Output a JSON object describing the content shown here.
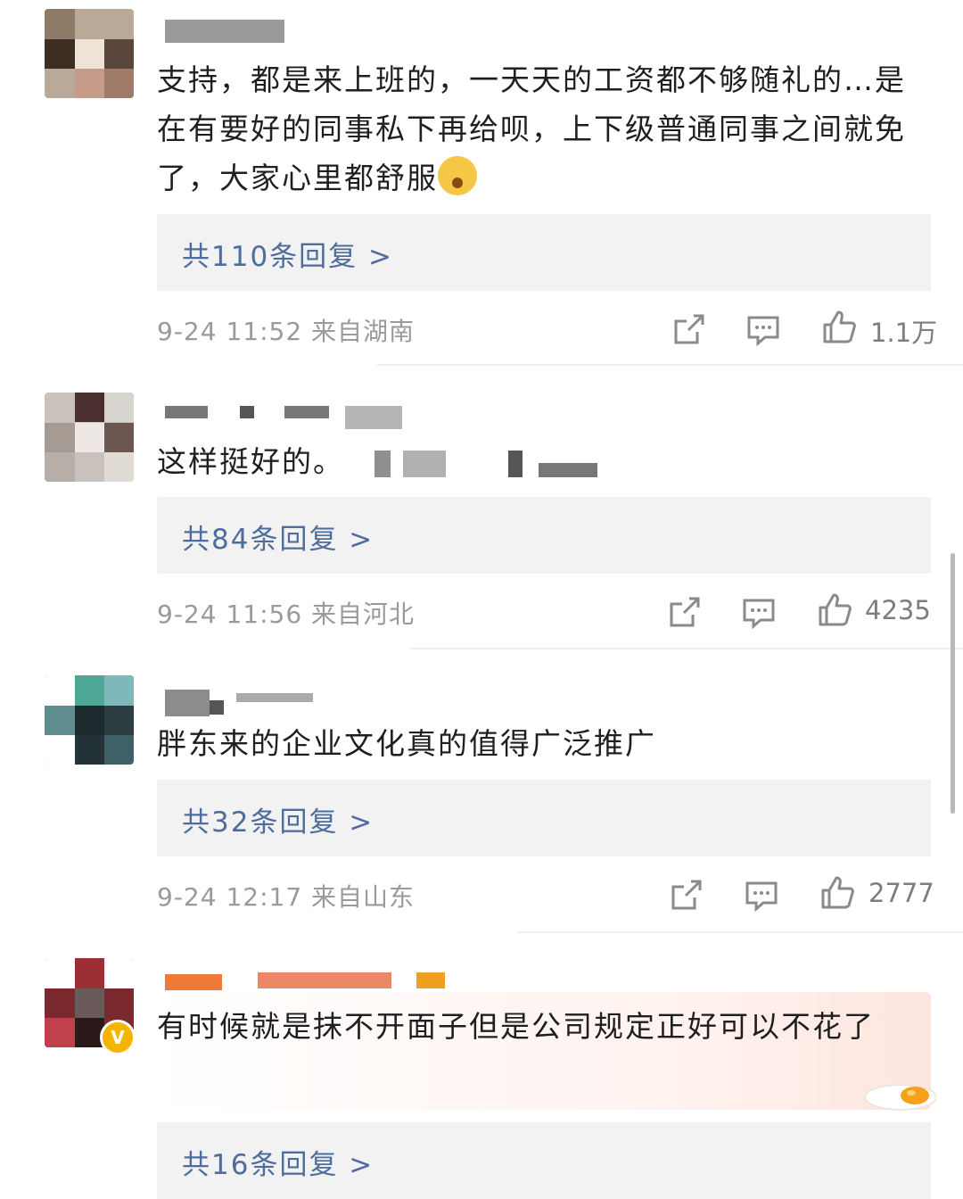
{
  "comments": [
    {
      "text": "支持，都是来上班的，一天天的工资都不够随礼的…是在有要好的同事私下再给呗，上下级普通同事之间就免了，大家心里都舒服",
      "emoji_icon": "face-covering-eyes-emoji",
      "replies": "共110条回复 >",
      "meta": "9-24 11:52  来自湖南",
      "likes": "1.1万"
    },
    {
      "text": "这样挺好的。",
      "replies": "共84条回复 >",
      "meta": "9-24 11:56  来自河北",
      "likes": "4235"
    },
    {
      "text": "胖东来的企业文化真的值得广泛推广",
      "replies": "共32条回复 >",
      "meta": "9-24 12:17  来自山东",
      "likes": "2777"
    },
    {
      "text": "有时候就是抹不开面子但是公司规定正好可以不花了",
      "verified_badge": "V",
      "replies": "共16条回复 >"
    }
  ],
  "colors": {
    "reply_link": "#4f6d9c",
    "meta_text": "#9a9a9a",
    "reply_bg": "#f2f2f2",
    "verified": "#f5b400"
  },
  "icons": [
    "share-icon",
    "comment-icon",
    "like-icon",
    "egg-decoration-icon"
  ]
}
